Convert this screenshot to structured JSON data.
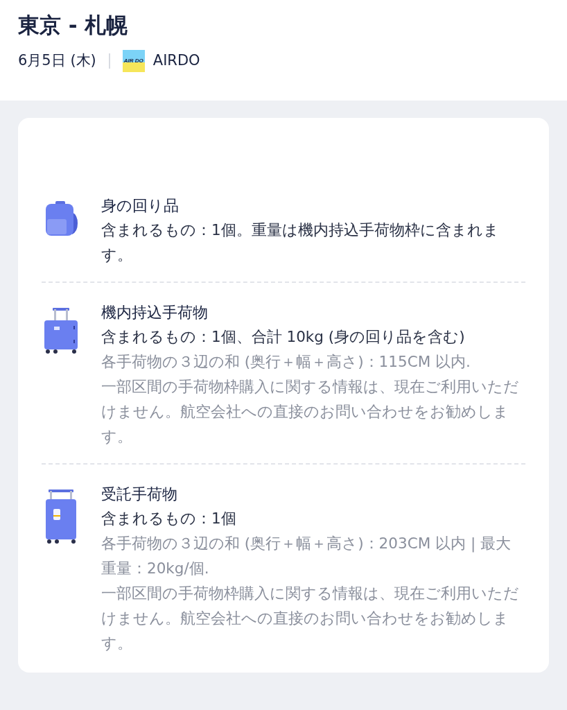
{
  "header": {
    "title": "東京 - 札幌",
    "date": "6月5日 (木)",
    "airline_logo_text": "AIR DO",
    "airline": "AIRDO"
  },
  "baggage": [
    {
      "kind": "backpack",
      "title": "身の回り品",
      "included": "含まれるもの：1個。重量は機内持込手荷物枠に含まれます。"
    },
    {
      "kind": "carry_on",
      "title": "機内持込手荷物",
      "included": "含まれるもの：1個、合計 10kg (身の回り品を含む)",
      "notes": [
        "各手荷物の３辺の和 (奥行＋幅＋高さ)：115CM 以内.",
        "一部区間の手荷物枠購入に関する情報は、現在ご利用いただけません。航空会社への直接のお問い合わせをお勧めします。"
      ]
    },
    {
      "kind": "checked",
      "title": "受託手荷物",
      "included": "含まれるもの：1個",
      "notes": [
        "各手荷物の３辺の和 (奥行＋幅＋高さ)：203CM 以内 | 最大重量：20kg/個.",
        "一部区間の手荷物枠購入に関する情報は、現在ご利用いただけません。航空会社への直接のお問い合わせをお勧めします。"
      ]
    }
  ]
}
